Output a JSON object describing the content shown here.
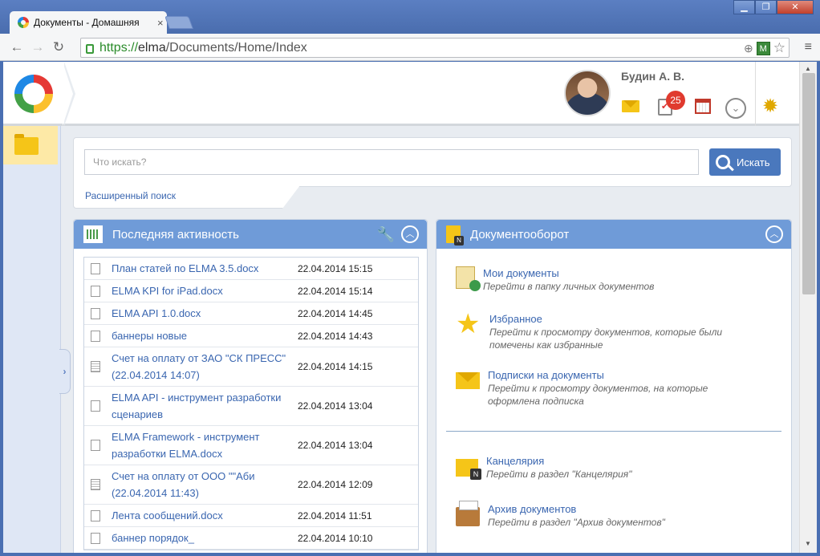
{
  "browser": {
    "tab_title": "Документы - Домашняя",
    "tab_close": "×",
    "url_scheme": "https://",
    "url_host": "elma",
    "url_path": "/Documents/Home/Index",
    "window_buttons": [
      "▁",
      "❐",
      "✕"
    ],
    "back": "←",
    "forward": "→",
    "reload": "↻",
    "zoom_icon": "⊕",
    "ext_icon": "M",
    "star_icon": "☆",
    "menu_icon": "≡"
  },
  "header": {
    "user_name": "Будин А. В.",
    "tasks_badge": "25",
    "dropdown_glyph": "⌄",
    "settings_glyph": "✹"
  },
  "search": {
    "placeholder": "Что искать?",
    "button_label": "Искать",
    "advanced_link": "Расширенный поиск"
  },
  "activity": {
    "title": "Последняя активность",
    "tool_glyph": "🔧",
    "collapse_glyph": "︿",
    "items": [
      {
        "name": "План статей по ELMA 3.5.docx",
        "date": "22.04.2014 15:15"
      },
      {
        "name": "ELMA KPI for iPad.docx",
        "date": "22.04.2014 15:14"
      },
      {
        "name": "ELMA API 1.0.docx",
        "date": "22.04.2014 14:45"
      },
      {
        "name": "баннеры новые",
        "date": "22.04.2014 14:43"
      },
      {
        "name": "Счет на оплату от ЗАО \"СК ПРЕСС\" (22.04.2014 14:07)",
        "date": "22.04.2014 14:15"
      },
      {
        "name": "ELMA API - инструмент разработки сценариев",
        "date": "22.04.2014 13:04"
      },
      {
        "name": "ELMA Framework - инструмент разработки ELMA.docx",
        "date": "22.04.2014 13:04"
      },
      {
        "name": "Счет на оплату от ООО \"\"Аби (22.04.2014 11:43)",
        "date": "22.04.2014 12:09"
      },
      {
        "name": "Лента сообщений.docx",
        "date": "22.04.2014 11:51"
      },
      {
        "name": "баннер порядок_",
        "date": "22.04.2014 10:10"
      }
    ]
  },
  "docflow": {
    "title": "Документооборот",
    "collapse_glyph": "︿",
    "items": [
      {
        "title": "Мои документы",
        "desc": "Перейти в папку личных документов"
      },
      {
        "title": "Избранное",
        "desc": "Перейти к просмотру документов, которые были помечены как избранные"
      },
      {
        "title": "Подписки на документы",
        "desc": "Перейти к просмотру документов, на которые оформлена подписка"
      },
      {
        "title": "Канцелярия",
        "desc": "Перейти в раздел \"Канцелярия\""
      },
      {
        "title": "Архив документов",
        "desc": "Перейти в раздел \"Архив документов\""
      }
    ]
  },
  "leftbar": {
    "expand_glyph": "›"
  },
  "scrollbar": {
    "up": "▲",
    "down": "▼"
  }
}
